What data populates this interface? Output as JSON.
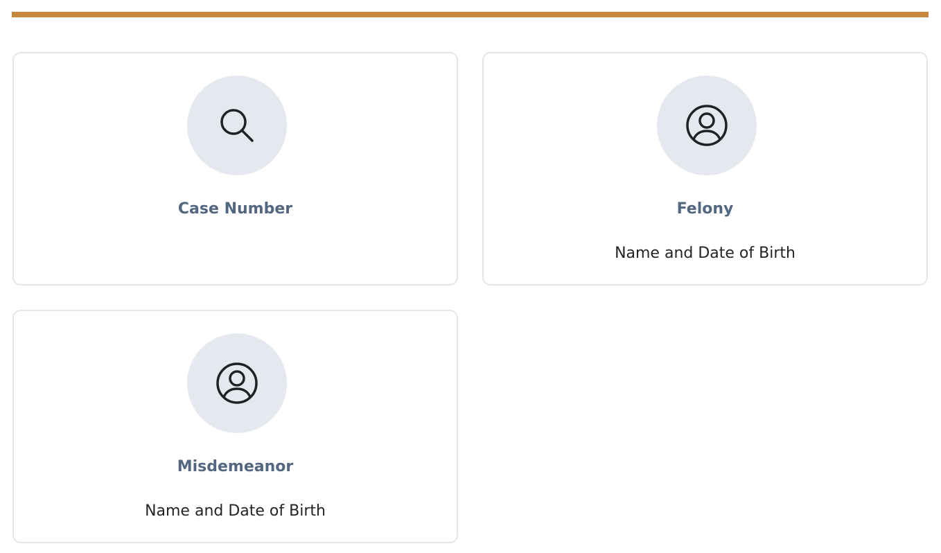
{
  "theme": {
    "accent_color": "#c8873a",
    "icon_circle_color": "#e5e9ef",
    "title_color": "#536780"
  },
  "search_options": [
    {
      "icon": "search-icon",
      "title": "Case Number",
      "subtitle": ""
    },
    {
      "icon": "user-circle-icon",
      "title": "Felony",
      "subtitle": "Name and Date of Birth"
    },
    {
      "icon": "user-circle-icon",
      "title": "Misdemeanor",
      "subtitle": "Name and Date of Birth"
    }
  ]
}
